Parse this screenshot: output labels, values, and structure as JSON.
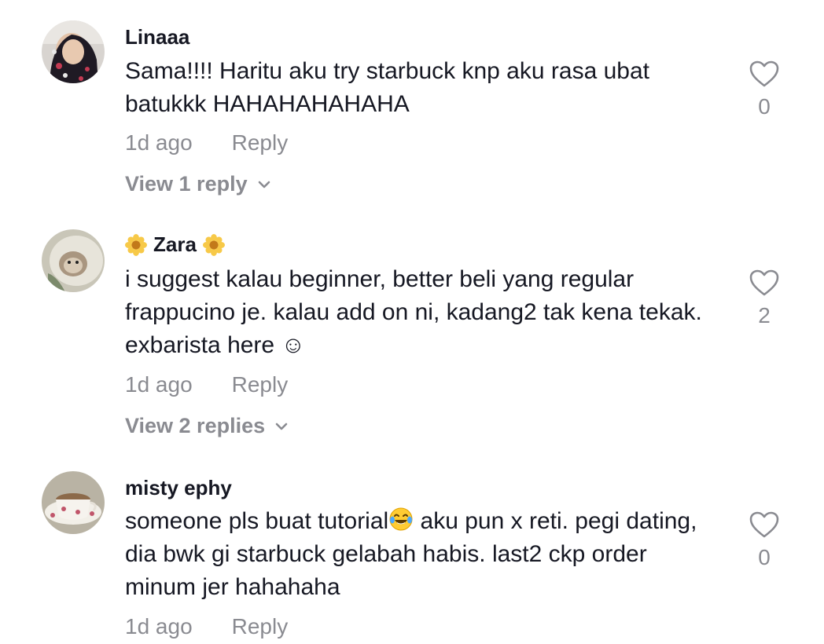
{
  "comments": [
    {
      "username": "Linaaa",
      "text": "Sama!!!! Haritu aku try starbuck knp aku rasa ubat batukkk HAHAHAHAHAHA",
      "time": "1d ago",
      "reply_label": "Reply",
      "view_replies": "View 1 reply",
      "like_count": "0"
    },
    {
      "username": "Zara",
      "username_decoration": "sunflower-emoji",
      "text": "i suggest kalau beginner, better beli yang regular frappucino je. kalau add on ni, kadang2 tak kena tekak. exbarista here ☺",
      "time": "1d ago",
      "reply_label": "Reply",
      "view_replies": "View 2 replies",
      "like_count": "2"
    },
    {
      "username": "misty ephy",
      "text_before_emoji": "someone pls buat tutorial",
      "emoji": "tears-of-joy-emoji",
      "text_after_emoji": " aku pun x reti. pegi dating, dia bwk gi starbuck gelabah habis. last2 ckp order minum jer hahahaha",
      "time": "1d ago",
      "reply_label": "Reply",
      "like_count": "0"
    }
  ],
  "icons": {
    "like": "heart-outline-icon",
    "expand": "chevron-down-icon"
  },
  "colors": {
    "text_primary": "#161823",
    "text_secondary": "#8a8b91",
    "background": "#ffffff"
  }
}
